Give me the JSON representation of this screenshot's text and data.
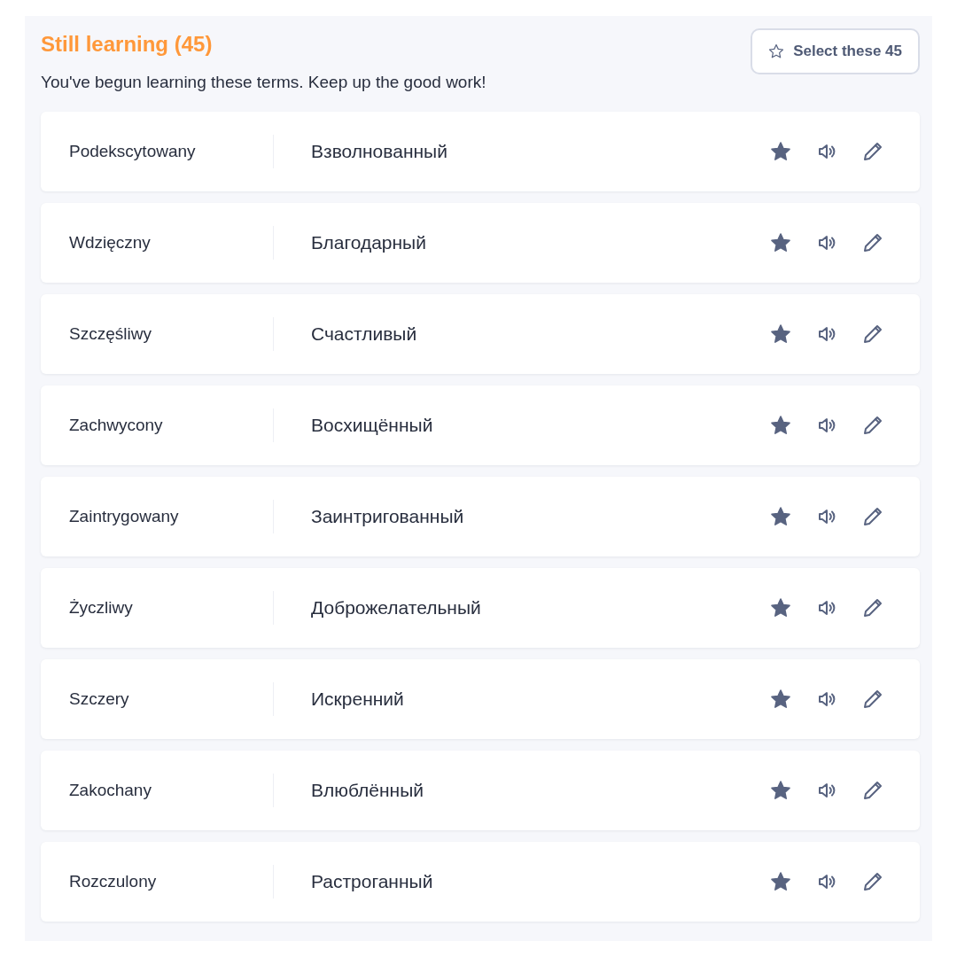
{
  "header": {
    "title": "Still learning (45)",
    "subtitle": "You've begun learning these terms. Keep up the good work!",
    "select_button": "Select these 45"
  },
  "terms": [
    {
      "term": "Podekscytowany",
      "definition": "Взволнованный",
      "starred": true
    },
    {
      "term": "Wdzięczny",
      "definition": "Благодарный",
      "starred": true
    },
    {
      "term": "Szczęśliwy",
      "definition": "Счастливый",
      "starred": true
    },
    {
      "term": "Zachwycony",
      "definition": "Восхищённый",
      "starred": true
    },
    {
      "term": "Zaintrygowany",
      "definition": "Заинтригованный",
      "starred": true
    },
    {
      "term": "Życzliwy",
      "definition": "Доброжелательный",
      "starred": true
    },
    {
      "term": "Szczery",
      "definition": "Искренний",
      "starred": true
    },
    {
      "term": "Zakochany",
      "definition": "Влюблённый",
      "starred": true
    },
    {
      "term": "Rozczulony",
      "definition": "Растроганный",
      "starred": true
    }
  ]
}
